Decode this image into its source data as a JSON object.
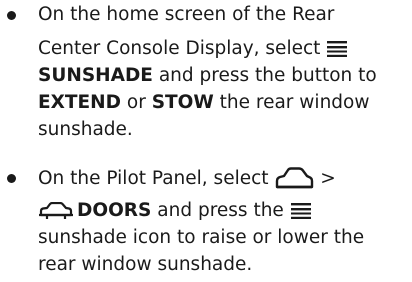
{
  "items": [
    {
      "line1": "On the home screen of the Rear",
      "line2_a": "Center Console Display, select ",
      "line3_a": "SUNSHADE",
      "line3_b": " and press the button to",
      "line4_a": "EXTEND",
      "line4_b": " or ",
      "line4_c": "STOW",
      "line4_d": " the rear window",
      "line5": "sunshade.",
      "icons": [
        "sunshade-icon"
      ]
    },
    {
      "line1_a": "On the Pilot Panel, select ",
      "line1_b": " >",
      "line2_a": "DOORS",
      "line2_b": " and press the ",
      "line3": "sunshade icon to raise or lower the",
      "line4": "rear window sunshade.",
      "icons": [
        "vehicle-top-icon",
        "vehicle-doors-icon",
        "sunshade-icon"
      ]
    }
  ],
  "colors": {
    "text": "#1a1a1a",
    "background": "#ffffff"
  }
}
